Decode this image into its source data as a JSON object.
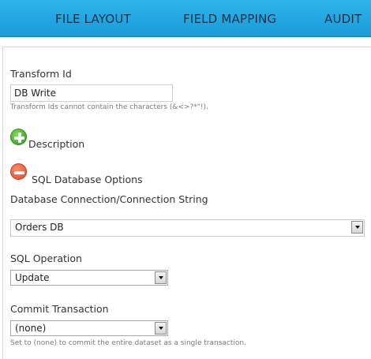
{
  "tabs": [
    {
      "label": "FILE LAYOUT"
    },
    {
      "label": "FIELD MAPPING"
    },
    {
      "label": "AUDIT"
    }
  ],
  "form": {
    "transform_id_label": "Transform Id",
    "transform_id_value": "DB Write",
    "transform_id_hint": "Transform Ids cannot contain the characters (&<>?*\"!).",
    "description_label": "Description",
    "sql_options_label": "SQL Database Options",
    "connection_label": "Database Connection/Connection String",
    "connection_value": "Orders DB",
    "sql_operation_label": "SQL Operation",
    "sql_operation_value": "Update",
    "commit_label": "Commit Transaction",
    "commit_value": "(none)",
    "commit_hint": "Set to (none) to commit the entire dataset as a single transaction."
  },
  "icons": {
    "add": "plus-circle-icon",
    "remove": "minus-circle-icon",
    "dropdown": "chevron-down-icon"
  },
  "colors": {
    "tab_bar": "#1fa6e0",
    "add_button": "#3aa623",
    "remove_button": "#e2553a"
  }
}
